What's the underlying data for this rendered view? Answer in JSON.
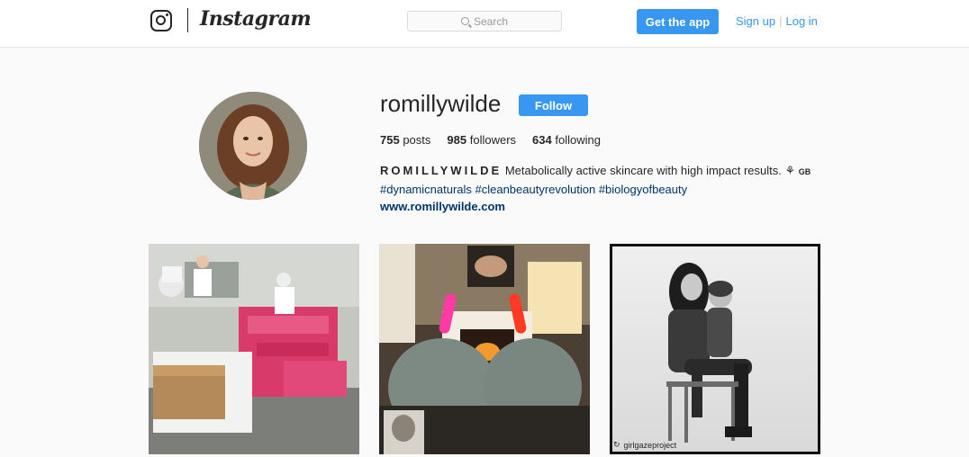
{
  "header": {
    "brand": "Instagram",
    "search_placeholder": "Search",
    "get_app_label": "Get the app",
    "sign_up_label": "Sign up",
    "separator": "|",
    "log_in_label": "Log in"
  },
  "profile": {
    "username": "romillywilde",
    "follow_label": "Follow",
    "stats": {
      "posts_count": "755",
      "posts_label": "posts",
      "followers_count": "985",
      "followers_label": "followers",
      "following_count": "634",
      "following_label": "following"
    },
    "bio": {
      "name": "ROMILLYWILDE",
      "text": "Metabolically active skincare with high impact results.",
      "country": "GB",
      "hashtags": "#dynamicnaturals #cleanbeautyrevolution #biologyofbeauty",
      "website": "www.romillywilde.com"
    }
  },
  "posts": [
    {
      "icon": "factory-photo"
    },
    {
      "icon": "fireplace-gloves-photo"
    },
    {
      "icon": "mother-child-photo",
      "credit": "girlgazeproject"
    }
  ],
  "colors": {
    "accent": "#3897f0",
    "link": "#003569",
    "background": "#fafafa"
  }
}
